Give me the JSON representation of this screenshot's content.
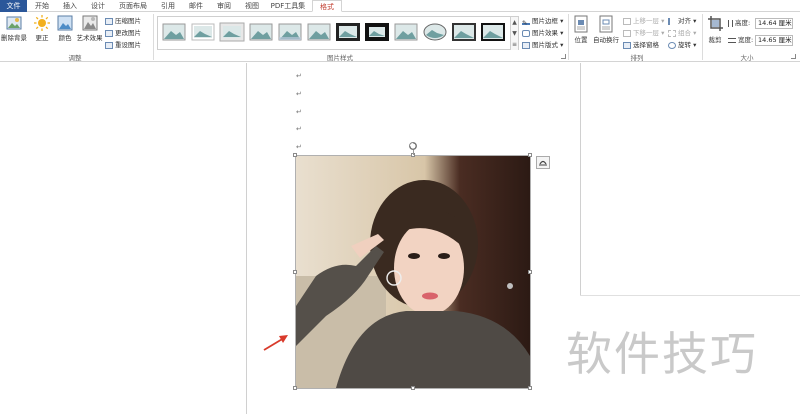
{
  "tabs": [
    "文件",
    "开始",
    "插入",
    "设计",
    "页面布局",
    "引用",
    "邮件",
    "审阅",
    "视图",
    "PDF工具集",
    "格式"
  ],
  "adjust": {
    "remove_bg": "删除背景",
    "corrections": "更正",
    "color": "颜色",
    "artistic": "艺术效果",
    "compress": "压缩图片",
    "change": "更改图片",
    "reset": "重设图片",
    "group_label": "调整"
  },
  "styles": {
    "group_label": "图片样式",
    "border": "图片边框",
    "effects": "图片效果",
    "layout": "图片版式"
  },
  "arrange": {
    "position": "位置",
    "wrap": "自动换行",
    "forward": "上移一层",
    "backward": "下移一层",
    "selection_pane": "选择窗格",
    "align": "对齐",
    "group": "组合",
    "rotate": "旋转",
    "group_label": "排列"
  },
  "size": {
    "crop": "裁剪",
    "height_label": "高度:",
    "height_value": "14.64 厘米",
    "width_label": "宽度:",
    "width_value": "14.65 厘米",
    "group_label": "大小"
  },
  "document": {
    "para_mark": "↵",
    "watermark": "软件技巧"
  },
  "colors": {
    "file_tab": "#2b579a",
    "active_tab_text": "#c0392b",
    "arrow": "#d93a2b"
  }
}
